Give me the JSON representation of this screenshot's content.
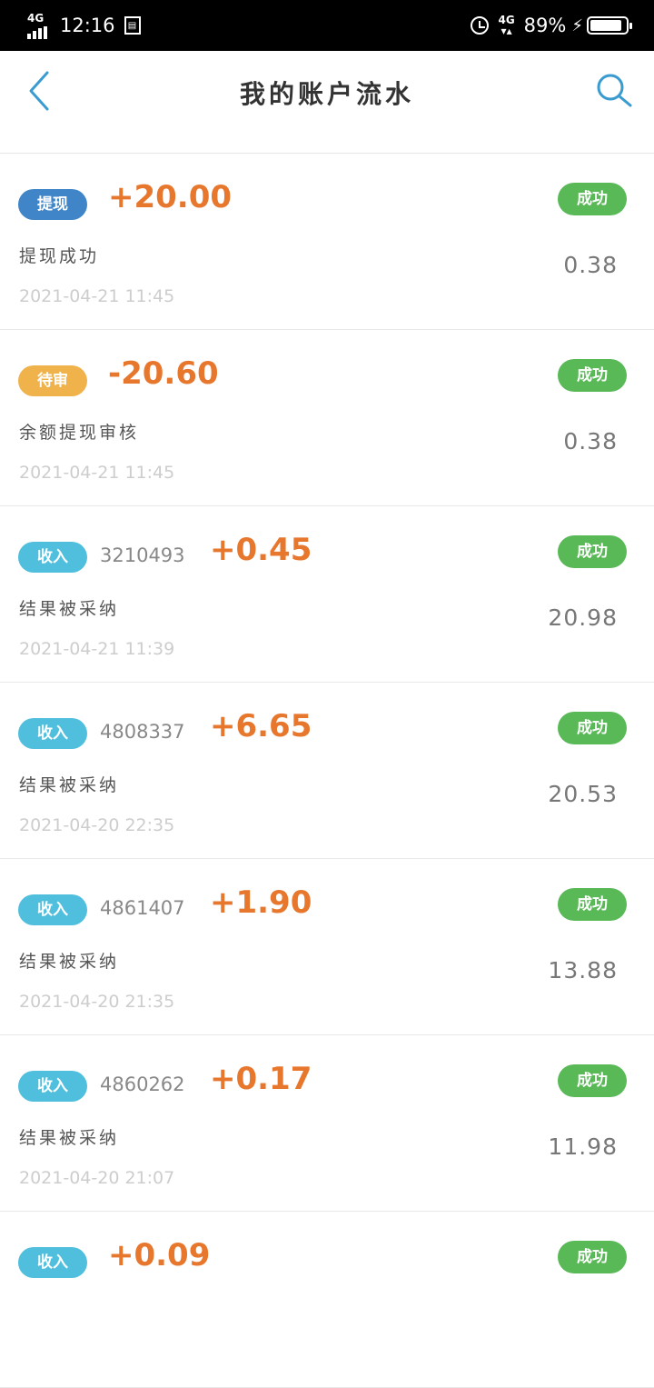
{
  "status_bar": {
    "network": "4G",
    "time": "12:16",
    "network2": "4G",
    "battery": "89%",
    "battery_level": 0.89
  },
  "header": {
    "title": "我的账户流水"
  },
  "colors": {
    "withdraw_tag": "#3f85c7",
    "pending_tag": "#f0b24a",
    "income_tag": "#4fbfdd",
    "status_success": "#59b957",
    "amount": "#e8772e"
  },
  "transactions": [
    {
      "tag": "提现",
      "order": "",
      "amount": "+20.00",
      "desc": "提现成功",
      "time": "2021-04-21 11:45",
      "status": "成功",
      "balance": "0.38"
    },
    {
      "tag": "待审",
      "order": "",
      "amount": "-20.60",
      "desc": "余额提现审核",
      "time": "2021-04-21 11:45",
      "status": "成功",
      "balance": "0.38"
    },
    {
      "tag": "收入",
      "order": "3210493",
      "amount": "+0.45",
      "desc": "结果被采纳",
      "time": "2021-04-21 11:39",
      "status": "成功",
      "balance": "20.98"
    },
    {
      "tag": "收入",
      "order": "4808337",
      "amount": "+6.65",
      "desc": "结果被采纳",
      "time": "2021-04-20 22:35",
      "status": "成功",
      "balance": "20.53"
    },
    {
      "tag": "收入",
      "order": "4861407",
      "amount": "+1.90",
      "desc": "结果被采纳",
      "time": "2021-04-20 21:35",
      "status": "成功",
      "balance": "13.88"
    },
    {
      "tag": "收入",
      "order": "4860262",
      "amount": "+0.17",
      "desc": "结果被采纳",
      "time": "2021-04-20 21:07",
      "status": "成功",
      "balance": "11.98"
    },
    {
      "tag": "收入",
      "order": "",
      "amount": "+0.09",
      "desc": "",
      "time": "",
      "status": "成功",
      "balance": ""
    }
  ]
}
